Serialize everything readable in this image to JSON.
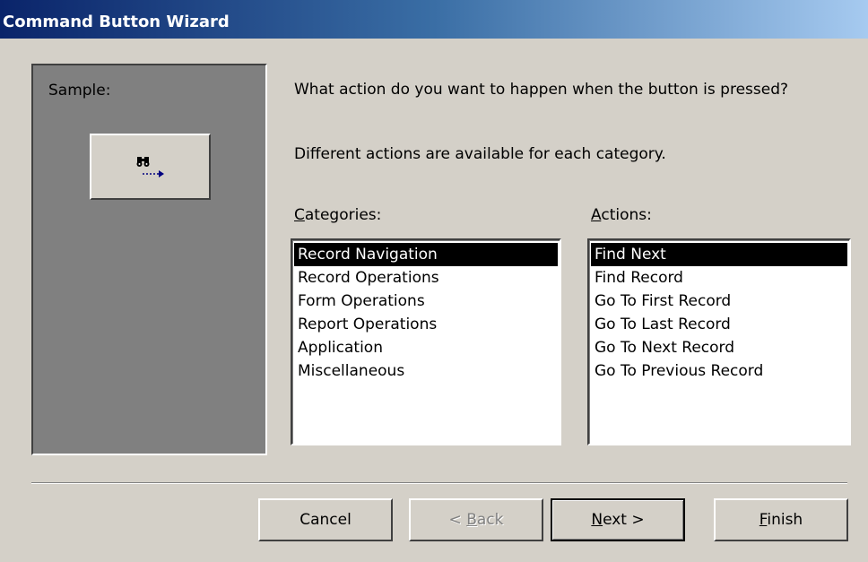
{
  "window": {
    "title": "Command Button Wizard"
  },
  "sample": {
    "label": "Sample:",
    "button_icon": "binoculars-find-next-icon"
  },
  "prompt": {
    "question": "What action do you want to happen when the button is pressed?",
    "subtext": "Different actions are available for each category."
  },
  "categories": {
    "label_acc": "C",
    "label_rest": "ategories:",
    "items": [
      "Record Navigation",
      "Record Operations",
      "Form Operations",
      "Report Operations",
      "Application",
      "Miscellaneous"
    ],
    "selected": "Record Navigation"
  },
  "actions": {
    "label_acc": "A",
    "label_rest": "ctions:",
    "items": [
      "Find Next",
      "Find Record",
      "Go To First Record",
      "Go To Last Record",
      "Go To Next Record",
      "Go To Previous Record"
    ],
    "selected": "Find Next"
  },
  "buttons": {
    "cancel": "Cancel",
    "back_pre": "< ",
    "back_acc": "B",
    "back_rest": "ack",
    "next_acc": "N",
    "next_rest": "ext >",
    "finish_acc": "F",
    "finish_rest": "inish"
  },
  "colors": {
    "titlebar_start": "#0a246a",
    "titlebar_end": "#a6caf0",
    "dialog_bg": "#d4d0c8",
    "selection_bg": "#000000"
  }
}
